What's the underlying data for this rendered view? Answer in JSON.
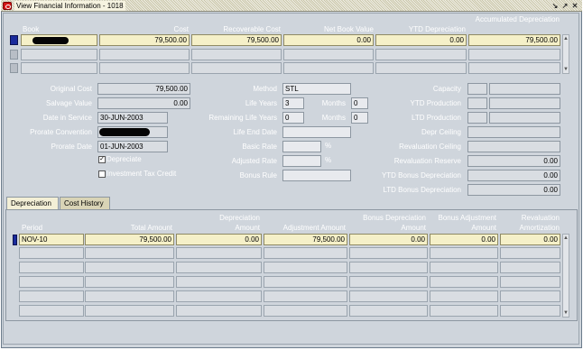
{
  "window": {
    "title": "View Financial Information - 1018"
  },
  "books_table": {
    "headers": [
      "Book",
      "Cost",
      "Recoverable Cost",
      "Net Book Value",
      "YTD Depreciation",
      "Accumulated Depreciation"
    ],
    "rows": [
      {
        "book": "",
        "cost": "79,500.00",
        "recoverable_cost": "79,500.00",
        "net_book_value": "0.00",
        "ytd_depreciation": "0.00",
        "accumulated_depreciation": "79,500.00"
      }
    ]
  },
  "details": {
    "original_cost_label": "Original Cost",
    "original_cost": "79,500.00",
    "salvage_value_label": "Salvage Value",
    "salvage_value": "0.00",
    "date_in_service_label": "Date in Service",
    "date_in_service": "30-JUN-2003",
    "prorate_convention_label": "Prorate Convention",
    "prorate_convention": "",
    "prorate_date_label": "Prorate Date",
    "prorate_date": "01-JUN-2003",
    "depreciate_label": "Depreciate",
    "depreciate_checked": true,
    "investment_tax_credit_label": "Investment Tax Credit",
    "investment_tax_credit_checked": false,
    "method_label": "Method",
    "method": "STL",
    "life_years_label": "Life Years",
    "life_years": "3",
    "life_months_label": "Months",
    "life_months": "0",
    "remaining_life_years_label": "Remaining Life Years",
    "remaining_life_years": "0",
    "remaining_months_label": "Months",
    "remaining_months": "0",
    "life_end_date_label": "Life End Date",
    "life_end_date": "",
    "basic_rate_label": "Basic Rate",
    "basic_rate": "",
    "basic_rate_unit": "%",
    "adjusted_rate_label": "Adjusted Rate",
    "adjusted_rate": "",
    "adjusted_rate_unit": "%",
    "bonus_rule_label": "Bonus Rule",
    "bonus_rule": "",
    "capacity_label": "Capacity",
    "ytd_production_label": "YTD Production",
    "ltd_production_label": "LTD Production",
    "depr_ceiling_label": "Depr Ceiling",
    "depr_ceiling": "",
    "revaluation_ceiling_label": "Revaluation Ceiling",
    "revaluation_ceiling": "",
    "revaluation_reserve_label": "Revaluation Reserve",
    "revaluation_reserve": "0.00",
    "ytd_bonus_depreciation_label": "YTD Bonus Depreciation",
    "ytd_bonus_depreciation": "0.00",
    "ltd_bonus_depreciation_label": "LTD Bonus Depreciation",
    "ltd_bonus_depreciation": "0.00"
  },
  "tabs": [
    {
      "label": "Depreciation",
      "active": true
    },
    {
      "label": "Cost History",
      "active": false
    }
  ],
  "depreciation_table": {
    "headers": [
      "Period",
      "Total Amount",
      "Depreciation Amount",
      "Adjustment Amount",
      "Bonus Depreciation Amount",
      "Bonus Adjustment Amount",
      "Revaluation Amortization"
    ],
    "rows": [
      {
        "period": "NOV-10",
        "total_amount": "79,500.00",
        "depreciation_amount": "0.00",
        "adjustment_amount": "79,500.00",
        "bonus_depreciation_amount": "0.00",
        "bonus_adjustment_amount": "0.00",
        "revaluation_amortization": "0.00"
      }
    ]
  },
  "colors": {
    "window_bg": "#cfd5dc",
    "active_row": "#f5f0c8",
    "indicator_active": "#1a2b9c",
    "label_text": "#ffffff"
  },
  "icons": [
    "oracle-app-icon",
    "minimize-icon",
    "maximize-icon",
    "close-icon",
    "scroll-up-icon",
    "scroll-down-icon"
  ]
}
